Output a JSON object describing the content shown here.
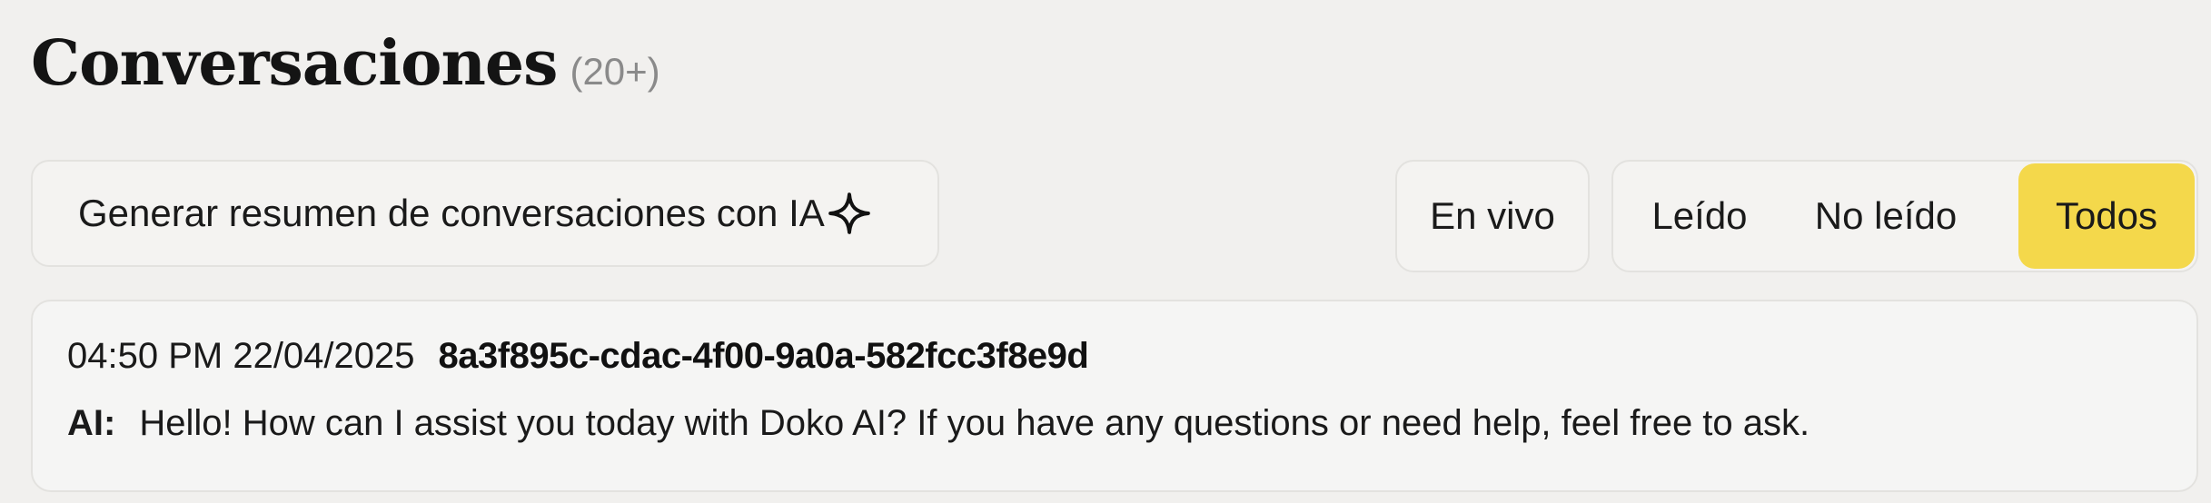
{
  "header": {
    "title": "Conversaciones",
    "count": "(20+)"
  },
  "summary_button": {
    "label": "Generar resumen de conversaciones con IA",
    "icon": "sparkle-icon"
  },
  "live_button": {
    "label": "En vivo"
  },
  "filters": {
    "read": "Leído",
    "unread": "No leído",
    "all": "Todos",
    "selected": "Todos",
    "selected_color": "#f4d84b"
  },
  "conversations": [
    {
      "time": "04:50 PM 22/04/2025",
      "id": "8a3f895c-cdac-4f00-9a0a-582fcc3f8e9d",
      "role": "AI:",
      "message": "Hello! How can I assist you today with Doko AI? If you have any questions or need help, feel free to ask."
    }
  ]
}
